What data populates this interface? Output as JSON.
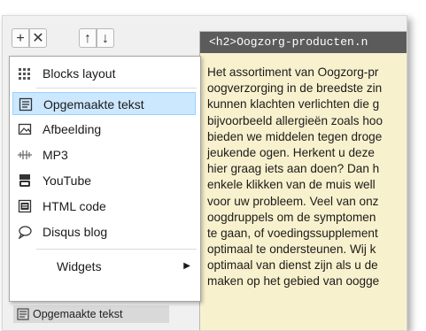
{
  "toolbar": {
    "plus": "+",
    "close": "✕",
    "up": "↑",
    "down": "↓"
  },
  "menu": {
    "items": [
      {
        "label": "Blocks layout",
        "icon": "blocks-layout-icon"
      },
      {
        "label": "Opgemaakte tekst",
        "icon": "formatted-text-icon",
        "selected": true
      },
      {
        "label": "Afbeelding",
        "icon": "image-icon"
      },
      {
        "label": "MP3",
        "icon": "audio-icon"
      },
      {
        "label": "YouTube",
        "icon": "youtube-icon"
      },
      {
        "label": "HTML code",
        "icon": "html-code-icon"
      },
      {
        "label": "Disqus blog",
        "icon": "comment-icon"
      },
      {
        "label": "Widgets",
        "icon": "",
        "submenu": true
      }
    ]
  },
  "block_list": {
    "current_item": "Opgemaakte tekst"
  },
  "editor": {
    "code_line": "<h2>Oogzorg-producten.n",
    "lines": [
      "Het assortiment van Oogzorg-pr",
      "oogverzorging in de breedste zin",
      "kunnen klachten verlichten die g",
      "bijvoorbeeld allergieën zoals hoo",
      "bieden we middelen tegen droge",
      "jeukende ogen. Herkent u deze",
      "hier graag iets aan doen? Dan h",
      "enkele klikken van de muis well",
      "voor uw probleem. Veel van onz",
      "oogdruppels om de symptomen",
      "te gaan, of voedingssupplement",
      "optimaal te ondersteunen. Wij k",
      "optimaal van dienst zijn als u de",
      "maken op het gebied van oogge"
    ]
  },
  "colors": {
    "selection": "#cce8ff",
    "editor_background": "#f8f1cd",
    "code_bar": "#5b5b5b"
  }
}
